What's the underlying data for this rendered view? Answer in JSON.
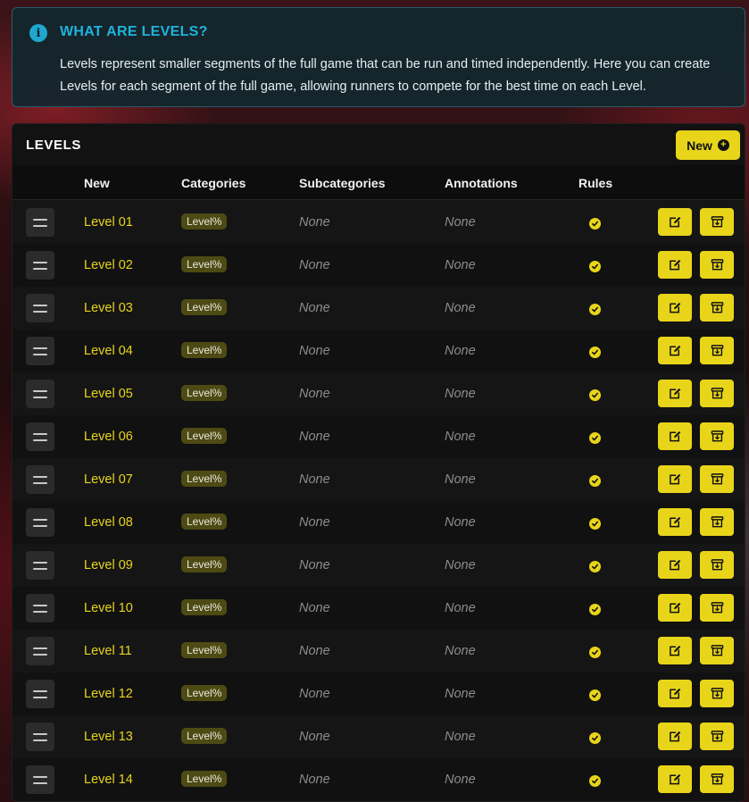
{
  "info": {
    "icon": "info-icon",
    "icon_glyph": "i",
    "title": "WHAT ARE LEVELS?",
    "text": "Levels represent smaller segments of the full game that can be run and timed independently. Here you can create Levels for each segment of the full game, allowing runners to compete for the best time on each Level."
  },
  "levels_panel": {
    "title": "LEVELS",
    "new_button_label": "New",
    "columns": {
      "name": "New",
      "categories": "Categories",
      "subcategories": "Subcategories",
      "annotations": "Annotations",
      "rules": "Rules"
    },
    "rows": [
      {
        "name": "Level 01",
        "category": "Level%",
        "subcategories": "None",
        "annotations": "None",
        "rules": true
      },
      {
        "name": "Level 02",
        "category": "Level%",
        "subcategories": "None",
        "annotations": "None",
        "rules": true
      },
      {
        "name": "Level 03",
        "category": "Level%",
        "subcategories": "None",
        "annotations": "None",
        "rules": true
      },
      {
        "name": "Level 04",
        "category": "Level%",
        "subcategories": "None",
        "annotations": "None",
        "rules": true
      },
      {
        "name": "Level 05",
        "category": "Level%",
        "subcategories": "None",
        "annotations": "None",
        "rules": true
      },
      {
        "name": "Level 06",
        "category": "Level%",
        "subcategories": "None",
        "annotations": "None",
        "rules": true
      },
      {
        "name": "Level 07",
        "category": "Level%",
        "subcategories": "None",
        "annotations": "None",
        "rules": true
      },
      {
        "name": "Level 08",
        "category": "Level%",
        "subcategories": "None",
        "annotations": "None",
        "rules": true
      },
      {
        "name": "Level 09",
        "category": "Level%",
        "subcategories": "None",
        "annotations": "None",
        "rules": true
      },
      {
        "name": "Level 10",
        "category": "Level%",
        "subcategories": "None",
        "annotations": "None",
        "rules": true
      },
      {
        "name": "Level 11",
        "category": "Level%",
        "subcategories": "None",
        "annotations": "None",
        "rules": true
      },
      {
        "name": "Level 12",
        "category": "Level%",
        "subcategories": "None",
        "annotations": "None",
        "rules": true
      },
      {
        "name": "Level 13",
        "category": "Level%",
        "subcategories": "None",
        "annotations": "None",
        "rules": true
      },
      {
        "name": "Level 14",
        "category": "Level%",
        "subcategories": "None",
        "annotations": "None",
        "rules": true
      }
    ]
  },
  "colors": {
    "accent": "#e8d51a",
    "info_accent": "#1fb3dd",
    "panel_bg": "#121212",
    "muted_text": "#8c8c8c"
  }
}
